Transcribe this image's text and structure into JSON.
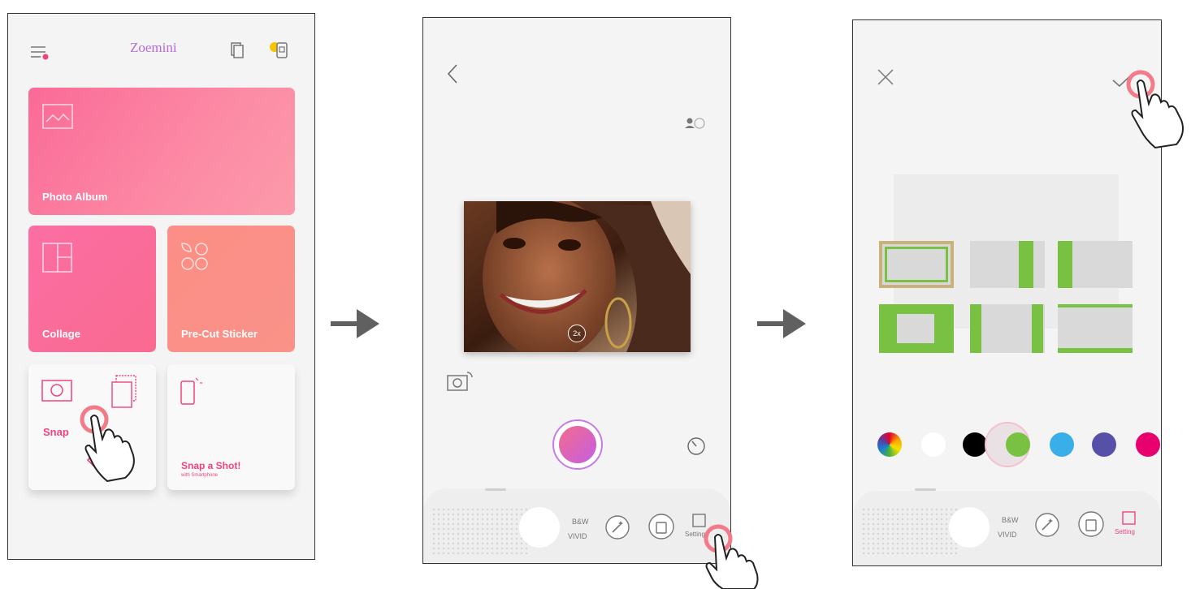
{
  "screen1": {
    "app_title": "Zoemini",
    "tiles": [
      {
        "label": "Photo Album"
      },
      {
        "label": "Collage"
      },
      {
        "label": "Pre-Cut Sticker"
      }
    ],
    "snap_label": "Snap",
    "snap_shot_title": "Snap a Shot!",
    "snap_shot_sub": "with Smartphone"
  },
  "screen2": {
    "zoom_label": "2x",
    "mode_bw": "B&W",
    "mode_vivid": "VIVID",
    "setting_label": "Setting"
  },
  "screen3": {
    "mode_bw": "B&W",
    "mode_vivid": "VIVID",
    "setting_label": "Setting",
    "colors": [
      "multicolor",
      "#ffffff",
      "#000000",
      "#79c143",
      "#3aaee8",
      "#5750a8",
      "#e8006f"
    ]
  },
  "colors": {
    "accent_pink": "#f0437c",
    "frame_green": "#79c143"
  }
}
